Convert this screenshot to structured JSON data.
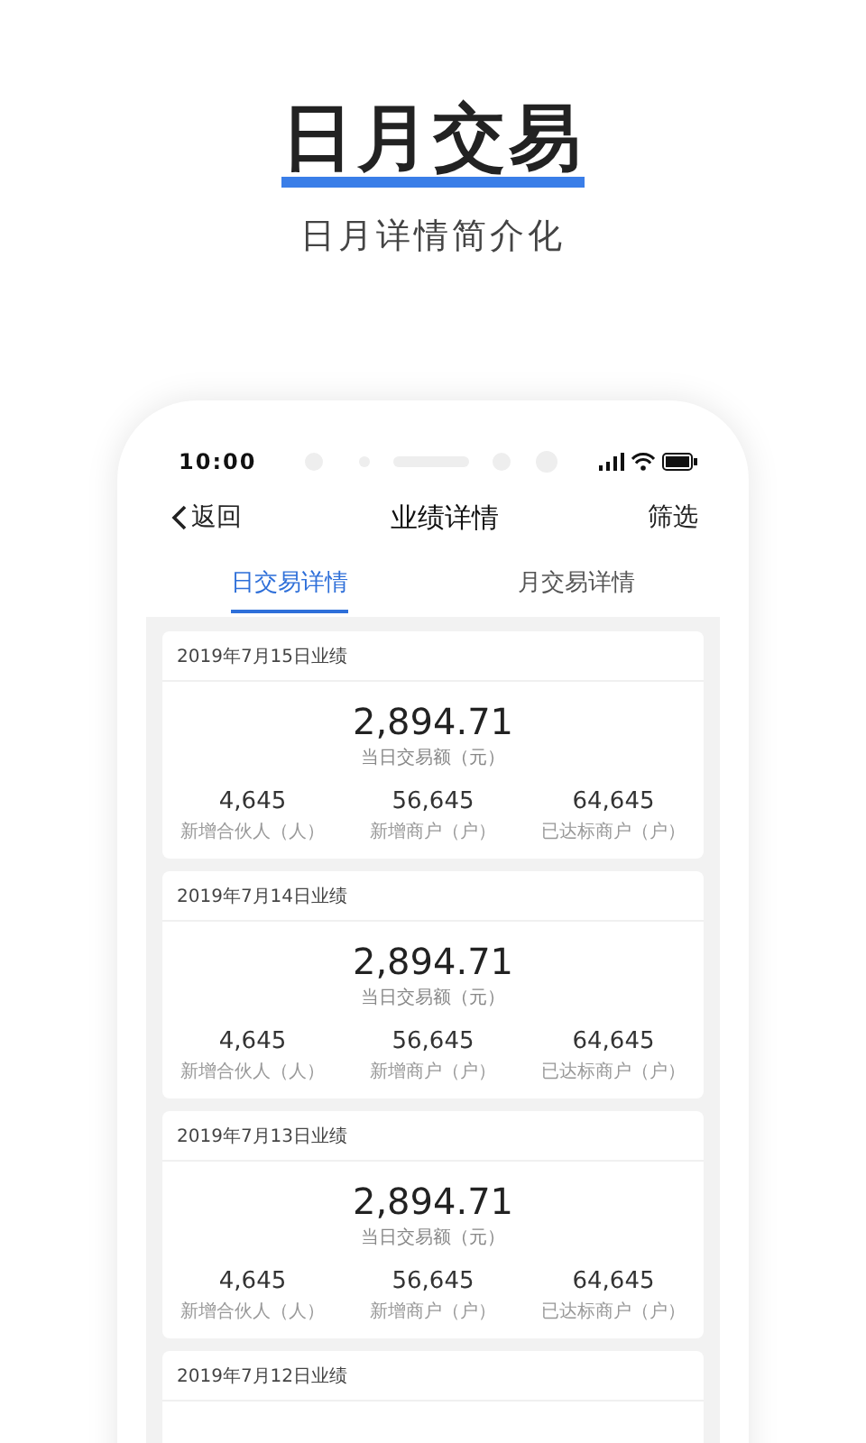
{
  "header": {
    "title": "日月交易",
    "subtitle": "日月详情简介化"
  },
  "status_bar": {
    "time": "10:00"
  },
  "nav": {
    "back": "返回",
    "title": "业绩详情",
    "action": "筛选"
  },
  "tabs": [
    {
      "label": "日交易详情",
      "selected": true
    },
    {
      "label": "月交易详情",
      "selected": false
    }
  ],
  "cards": [
    {
      "title": "2019年7月15日业绩",
      "amount": "2,894.71",
      "amount_label": "当日交易额（元）",
      "stats": [
        {
          "value": "4,645",
          "label": "新增合伙人（人）"
        },
        {
          "value": "56,645",
          "label": "新增商户（户）"
        },
        {
          "value": "64,645",
          "label": "已达标商户（户）"
        }
      ]
    },
    {
      "title": "2019年7月14日业绩",
      "amount": "2,894.71",
      "amount_label": "当日交易额（元）",
      "stats": [
        {
          "value": "4,645",
          "label": "新增合伙人（人）"
        },
        {
          "value": "56,645",
          "label": "新增商户（户）"
        },
        {
          "value": "64,645",
          "label": "已达标商户（户）"
        }
      ]
    },
    {
      "title": "2019年7月13日业绩",
      "amount": "2,894.71",
      "amount_label": "当日交易额（元）",
      "stats": [
        {
          "value": "4,645",
          "label": "新增合伙人（人）"
        },
        {
          "value": "56,645",
          "label": "新增商户（户）"
        },
        {
          "value": "64,645",
          "label": "已达标商户（户）"
        }
      ]
    },
    {
      "title": "2019年7月12日业绩"
    }
  ]
}
